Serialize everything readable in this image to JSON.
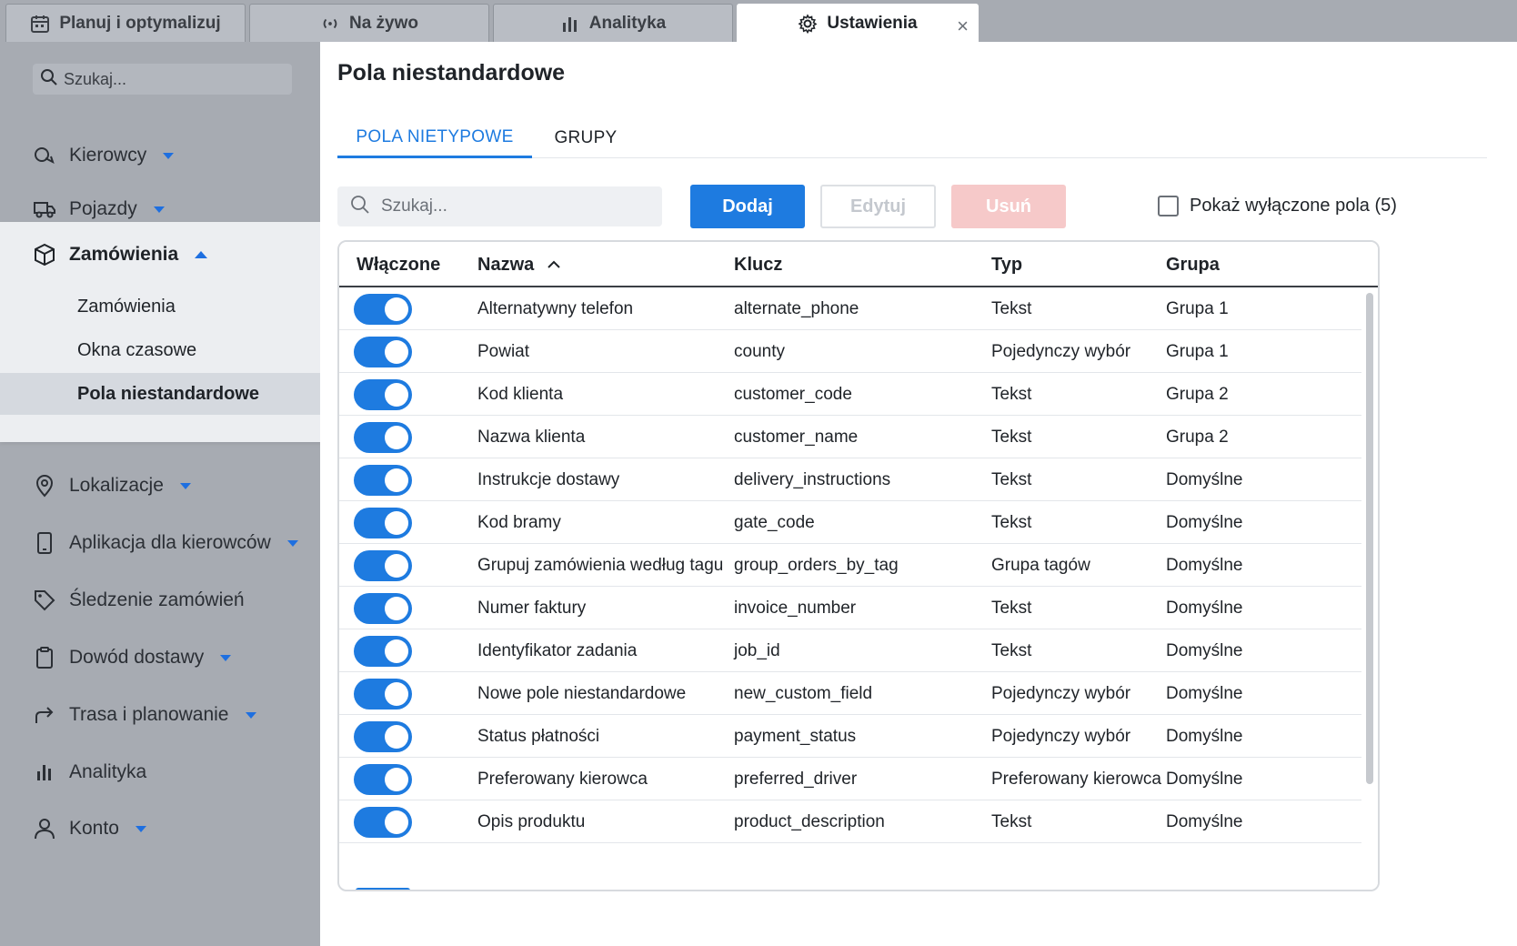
{
  "tabs": [
    {
      "label": "Planuj i optymalizuj",
      "icon": "calendar-icon"
    },
    {
      "label": "Na żywo",
      "icon": "broadcast-icon"
    },
    {
      "label": "Analityka",
      "icon": "bar-chart-icon"
    },
    {
      "label": "Ustawienia",
      "icon": "gear-icon",
      "active": true
    }
  ],
  "sidebar": {
    "search_placeholder": "Szukaj...",
    "items": [
      {
        "label": "Kierowcy",
        "icon": "drivers-icon",
        "caret": "down"
      },
      {
        "label": "Pojazdy",
        "icon": "truck-icon",
        "caret": "down"
      },
      {
        "label": "Zamówienia",
        "icon": "package-icon",
        "caret": "up",
        "expanded": true
      },
      {
        "label": "Lokalizacje",
        "icon": "map-pin-icon",
        "caret": "down"
      },
      {
        "label": "Aplikacja dla kierowców",
        "icon": "phone-icon",
        "caret": "down"
      },
      {
        "label": "Śledzenie zamówień",
        "icon": "tag-icon",
        "caret": "none"
      },
      {
        "label": "Dowód dostawy",
        "icon": "clipboard-icon",
        "caret": "down"
      },
      {
        "label": "Trasa i planowanie",
        "icon": "route-arrow-icon",
        "caret": "down"
      },
      {
        "label": "Analityka",
        "icon": "analytics-icon",
        "caret": "none"
      },
      {
        "label": "Konto",
        "icon": "user-icon",
        "caret": "down"
      }
    ],
    "subitems": [
      {
        "label": "Zamówienia"
      },
      {
        "label": "Okna czasowe"
      },
      {
        "label": "Pola niestandardowe",
        "selected": true
      }
    ]
  },
  "main": {
    "title": "Pola niestandardowe",
    "subtabs": [
      {
        "label": "POLA NIETYPOWE",
        "active": true
      },
      {
        "label": "GRUPY"
      }
    ],
    "search_placeholder": "Szukaj...",
    "buttons": {
      "add": "Dodaj",
      "edit": "Edytuj",
      "delete": "Usuń"
    },
    "show_disabled_label": "Pokaż wyłączone pola (5)",
    "table": {
      "headers": {
        "enabled": "Włączone",
        "name": "Nazwa",
        "key": "Klucz",
        "type": "Typ",
        "group": "Grupa"
      },
      "rows": [
        {
          "enabled": true,
          "name": "Alternatywny telefon",
          "key": "alternate_phone",
          "type": "Tekst",
          "group": "Grupa 1"
        },
        {
          "enabled": true,
          "name": "Powiat",
          "key": "county",
          "type": "Pojedynczy wybór",
          "group": "Grupa 1"
        },
        {
          "enabled": true,
          "name": "Kod klienta",
          "key": "customer_code",
          "type": "Tekst",
          "group": "Grupa 2"
        },
        {
          "enabled": true,
          "name": "Nazwa klienta",
          "key": "customer_name",
          "type": "Tekst",
          "group": "Grupa 2"
        },
        {
          "enabled": true,
          "name": "Instrukcje dostawy",
          "key": "delivery_instructions",
          "type": "Tekst",
          "group": "Domyślne"
        },
        {
          "enabled": true,
          "name": "Kod bramy",
          "key": "gate_code",
          "type": "Tekst",
          "group": "Domyślne"
        },
        {
          "enabled": true,
          "name": "Grupuj zamówienia według tagu",
          "key": "group_orders_by_tag",
          "type": "Grupa tagów",
          "group": "Domyślne"
        },
        {
          "enabled": true,
          "name": "Numer faktury",
          "key": "invoice_number",
          "type": "Tekst",
          "group": "Domyślne"
        },
        {
          "enabled": true,
          "name": "Identyfikator zadania",
          "key": "job_id",
          "type": "Tekst",
          "group": "Domyślne"
        },
        {
          "enabled": true,
          "name": "Nowe pole niestandardowe",
          "key": "new_custom_field",
          "type": "Pojedynczy wybór",
          "group": "Domyślne"
        },
        {
          "enabled": true,
          "name": "Status płatności",
          "key": "payment_status",
          "type": "Pojedynczy wybór",
          "group": "Domyślne"
        },
        {
          "enabled": true,
          "name": "Preferowany kierowca",
          "key": "preferred_driver",
          "type": "Preferowany kierowca",
          "group": "Domyślne"
        },
        {
          "enabled": true,
          "name": "Opis produktu",
          "key": "product_description",
          "type": "Tekst",
          "group": "Domyślne"
        }
      ]
    }
  },
  "colors": {
    "accent": "#1e7be0",
    "sidebar_bg": "#a7abb2",
    "danger_disabled": "#f6c9c9"
  }
}
